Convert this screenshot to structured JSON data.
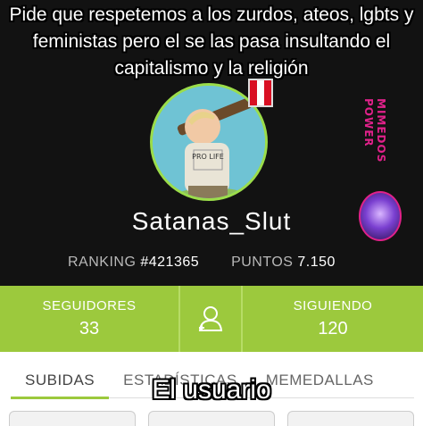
{
  "meme": {
    "caption_top": "Pide que respetemos a los zurdos, ateos, lgbts y feministas pero el se las pasa insultando el capitalismo y la religión",
    "caption_bottom": "El usuario"
  },
  "profile": {
    "username": "Satanas_Slut",
    "ranking_label": "RANKING",
    "ranking_value": "#421365",
    "points_label": "PUNTOS",
    "points_value": "7.150",
    "avatar_sign_text": "PRO LIFE",
    "side_logo_text": "MIMEDOS POWER"
  },
  "stats": {
    "followers_label": "SEGUIDORES",
    "followers_value": "33",
    "following_label": "SIGUIENDO",
    "following_value": "120"
  },
  "tabs": [
    {
      "label": "SUBIDAS"
    },
    {
      "label": "ESTADÍSTICAS"
    },
    {
      "label": "MEMEDALLAS"
    }
  ],
  "colors": {
    "accent": "#9cc93d",
    "background": "#121212",
    "username": "#ffffff",
    "stats_text": "#b8b8b8",
    "flag_red": "#d91023",
    "side_logo": "#e0218a"
  },
  "icons": {
    "follow_button": "add-user-icon",
    "avatar_badge": "peru-flag-icon"
  }
}
